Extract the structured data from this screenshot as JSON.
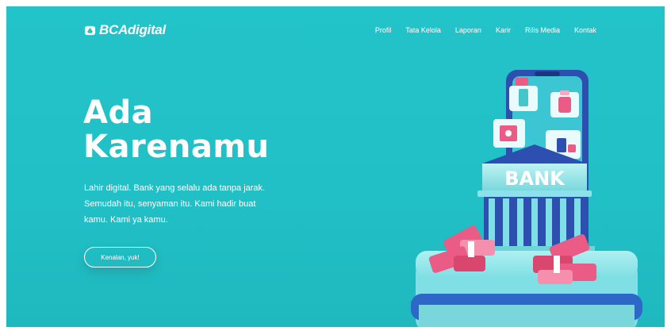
{
  "brand": {
    "name": "BCAdigital"
  },
  "nav": {
    "items": [
      {
        "label": "Profil"
      },
      {
        "label": "Tata Kelola"
      },
      {
        "label": "Laporan"
      },
      {
        "label": "Karir"
      },
      {
        "label": "Rilis Media"
      },
      {
        "label": "Kontak"
      }
    ]
  },
  "hero": {
    "title_line1": "Ada",
    "title_line2": "Karenamu",
    "description": "Lahir digital. Bank yang selalu ada tanpa jarak. Semudah itu, senyaman itu. Kami hadir buat kamu. Kami ya kamu.",
    "cta_label": "Kenalan, yuk!"
  },
  "illustration": {
    "bank_sign": "BANK"
  },
  "colors": {
    "background": "#21c0c6",
    "text": "#ffffff",
    "phone": "#2d4fb0",
    "money": "#ea5c86"
  }
}
